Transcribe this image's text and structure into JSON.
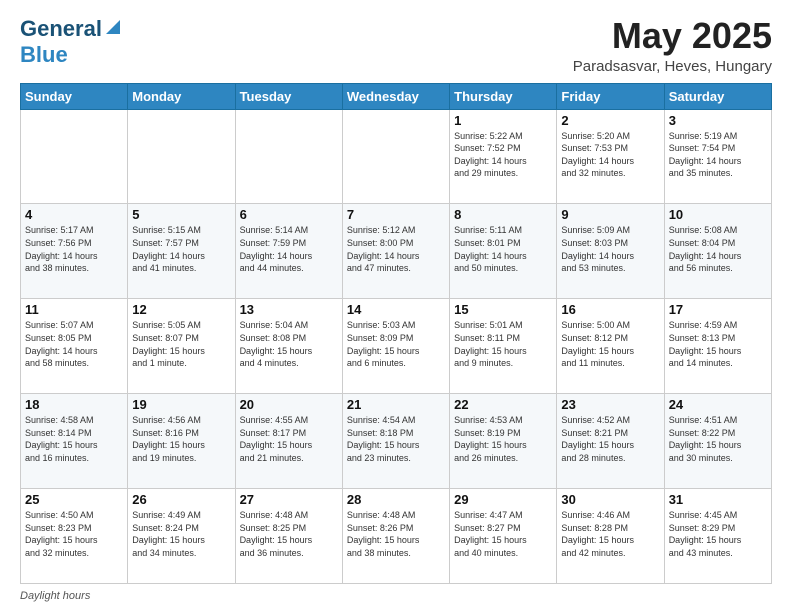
{
  "header": {
    "logo_general": "General",
    "logo_blue": "Blue",
    "title": "May 2025",
    "subtitle": "Paradsasvar, Heves, Hungary"
  },
  "footer": {
    "daylight_label": "Daylight hours"
  },
  "days_of_week": [
    "Sunday",
    "Monday",
    "Tuesday",
    "Wednesday",
    "Thursday",
    "Friday",
    "Saturday"
  ],
  "weeks": [
    [
      {
        "day": "",
        "info": ""
      },
      {
        "day": "",
        "info": ""
      },
      {
        "day": "",
        "info": ""
      },
      {
        "day": "",
        "info": ""
      },
      {
        "day": "1",
        "info": "Sunrise: 5:22 AM\nSunset: 7:52 PM\nDaylight: 14 hours\nand 29 minutes."
      },
      {
        "day": "2",
        "info": "Sunrise: 5:20 AM\nSunset: 7:53 PM\nDaylight: 14 hours\nand 32 minutes."
      },
      {
        "day": "3",
        "info": "Sunrise: 5:19 AM\nSunset: 7:54 PM\nDaylight: 14 hours\nand 35 minutes."
      }
    ],
    [
      {
        "day": "4",
        "info": "Sunrise: 5:17 AM\nSunset: 7:56 PM\nDaylight: 14 hours\nand 38 minutes."
      },
      {
        "day": "5",
        "info": "Sunrise: 5:15 AM\nSunset: 7:57 PM\nDaylight: 14 hours\nand 41 minutes."
      },
      {
        "day": "6",
        "info": "Sunrise: 5:14 AM\nSunset: 7:59 PM\nDaylight: 14 hours\nand 44 minutes."
      },
      {
        "day": "7",
        "info": "Sunrise: 5:12 AM\nSunset: 8:00 PM\nDaylight: 14 hours\nand 47 minutes."
      },
      {
        "day": "8",
        "info": "Sunrise: 5:11 AM\nSunset: 8:01 PM\nDaylight: 14 hours\nand 50 minutes."
      },
      {
        "day": "9",
        "info": "Sunrise: 5:09 AM\nSunset: 8:03 PM\nDaylight: 14 hours\nand 53 minutes."
      },
      {
        "day": "10",
        "info": "Sunrise: 5:08 AM\nSunset: 8:04 PM\nDaylight: 14 hours\nand 56 minutes."
      }
    ],
    [
      {
        "day": "11",
        "info": "Sunrise: 5:07 AM\nSunset: 8:05 PM\nDaylight: 14 hours\nand 58 minutes."
      },
      {
        "day": "12",
        "info": "Sunrise: 5:05 AM\nSunset: 8:07 PM\nDaylight: 15 hours\nand 1 minute."
      },
      {
        "day": "13",
        "info": "Sunrise: 5:04 AM\nSunset: 8:08 PM\nDaylight: 15 hours\nand 4 minutes."
      },
      {
        "day": "14",
        "info": "Sunrise: 5:03 AM\nSunset: 8:09 PM\nDaylight: 15 hours\nand 6 minutes."
      },
      {
        "day": "15",
        "info": "Sunrise: 5:01 AM\nSunset: 8:11 PM\nDaylight: 15 hours\nand 9 minutes."
      },
      {
        "day": "16",
        "info": "Sunrise: 5:00 AM\nSunset: 8:12 PM\nDaylight: 15 hours\nand 11 minutes."
      },
      {
        "day": "17",
        "info": "Sunrise: 4:59 AM\nSunset: 8:13 PM\nDaylight: 15 hours\nand 14 minutes."
      }
    ],
    [
      {
        "day": "18",
        "info": "Sunrise: 4:58 AM\nSunset: 8:14 PM\nDaylight: 15 hours\nand 16 minutes."
      },
      {
        "day": "19",
        "info": "Sunrise: 4:56 AM\nSunset: 8:16 PM\nDaylight: 15 hours\nand 19 minutes."
      },
      {
        "day": "20",
        "info": "Sunrise: 4:55 AM\nSunset: 8:17 PM\nDaylight: 15 hours\nand 21 minutes."
      },
      {
        "day": "21",
        "info": "Sunrise: 4:54 AM\nSunset: 8:18 PM\nDaylight: 15 hours\nand 23 minutes."
      },
      {
        "day": "22",
        "info": "Sunrise: 4:53 AM\nSunset: 8:19 PM\nDaylight: 15 hours\nand 26 minutes."
      },
      {
        "day": "23",
        "info": "Sunrise: 4:52 AM\nSunset: 8:21 PM\nDaylight: 15 hours\nand 28 minutes."
      },
      {
        "day": "24",
        "info": "Sunrise: 4:51 AM\nSunset: 8:22 PM\nDaylight: 15 hours\nand 30 minutes."
      }
    ],
    [
      {
        "day": "25",
        "info": "Sunrise: 4:50 AM\nSunset: 8:23 PM\nDaylight: 15 hours\nand 32 minutes."
      },
      {
        "day": "26",
        "info": "Sunrise: 4:49 AM\nSunset: 8:24 PM\nDaylight: 15 hours\nand 34 minutes."
      },
      {
        "day": "27",
        "info": "Sunrise: 4:48 AM\nSunset: 8:25 PM\nDaylight: 15 hours\nand 36 minutes."
      },
      {
        "day": "28",
        "info": "Sunrise: 4:48 AM\nSunset: 8:26 PM\nDaylight: 15 hours\nand 38 minutes."
      },
      {
        "day": "29",
        "info": "Sunrise: 4:47 AM\nSunset: 8:27 PM\nDaylight: 15 hours\nand 40 minutes."
      },
      {
        "day": "30",
        "info": "Sunrise: 4:46 AM\nSunset: 8:28 PM\nDaylight: 15 hours\nand 42 minutes."
      },
      {
        "day": "31",
        "info": "Sunrise: 4:45 AM\nSunset: 8:29 PM\nDaylight: 15 hours\nand 43 minutes."
      }
    ]
  ]
}
